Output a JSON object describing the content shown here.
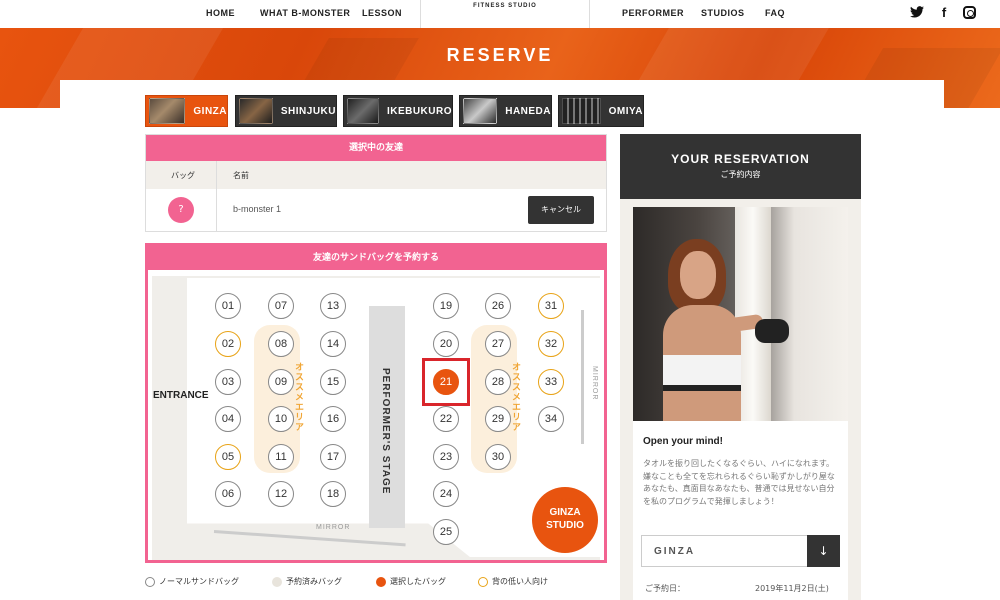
{
  "nav": {
    "left": [
      "HOME",
      "WHAT B-MONSTER",
      "LESSON"
    ],
    "logo_sub": "FITNESS STUDIO",
    "right": [
      "PERFORMER",
      "STUDIOS",
      "FAQ"
    ],
    "social_icons": [
      "twitter-icon",
      "facebook-icon",
      "instagram-icon"
    ]
  },
  "hero": {
    "title": "RESERVE"
  },
  "tabs": [
    {
      "label": "GINZA",
      "active": true
    },
    {
      "label": "SHINJUKU",
      "active": false
    },
    {
      "label": "IKEBUKURO",
      "active": false
    },
    {
      "label": "HANEDA",
      "active": false
    },
    {
      "label": "OMIYA",
      "active": false
    }
  ],
  "friends": {
    "header": "選択中の友達",
    "col_bag": "バッグ",
    "col_name": "名前",
    "row": {
      "bag": "?",
      "name": "b-monster 1",
      "action": "キャンセル"
    }
  },
  "seatmap": {
    "header": "友達のサンドバッグを予約する",
    "entrance": "ENTRANCE",
    "stage": "PERFORMER'S STAGE",
    "recommended": "オススメエリア",
    "mirror": "MIRROR",
    "studio_badge_line1": "GINZA",
    "studio_badge_line2": "STUDIO",
    "seats": {
      "s01": "01",
      "s02": "02",
      "s03": "03",
      "s04": "04",
      "s05": "05",
      "s06": "06",
      "s07": "07",
      "s08": "08",
      "s09": "09",
      "s10": "10",
      "s11": "11",
      "s12": "12",
      "s13": "13",
      "s14": "14",
      "s15": "15",
      "s16": "16",
      "s17": "17",
      "s18": "18",
      "s19": "19",
      "s20": "20",
      "s21": "21",
      "s22": "22",
      "s23": "23",
      "s24": "24",
      "s25": "25",
      "s26": "26",
      "s27": "27",
      "s28": "28",
      "s29": "29",
      "s30": "30",
      "s31": "31",
      "s32": "32",
      "s33": "33",
      "s34": "34"
    },
    "selected_seat": "21",
    "low_height_seats": [
      "02",
      "05",
      "31",
      "32",
      "33"
    ]
  },
  "legend": {
    "normal": "ノーマルサンドバッグ",
    "reserved": "予約済みバッグ",
    "selected": "選択したバッグ",
    "low": "背の低い人向け"
  },
  "sidebar": {
    "title": "YOUR RESERVATION",
    "subtitle": "ご予約内容",
    "card_title": "Open your mind!",
    "card_text": "タオルを振り回したくなるぐらい、ハイになれます。嫌なことも全てを忘れられるぐらい恥ずかしがり屋なあなたも、真面目なあなたも、普通では見せない自分を私のプログラムで発揮しましょう！",
    "studio_value": "GINZA",
    "date_label": "ご予約日：",
    "date_value": "2019年11月2日(土)"
  },
  "colors": {
    "accent": "#e8540f",
    "pink": "#f26391",
    "dark": "#333333",
    "low_ring": "#e8a317"
  }
}
